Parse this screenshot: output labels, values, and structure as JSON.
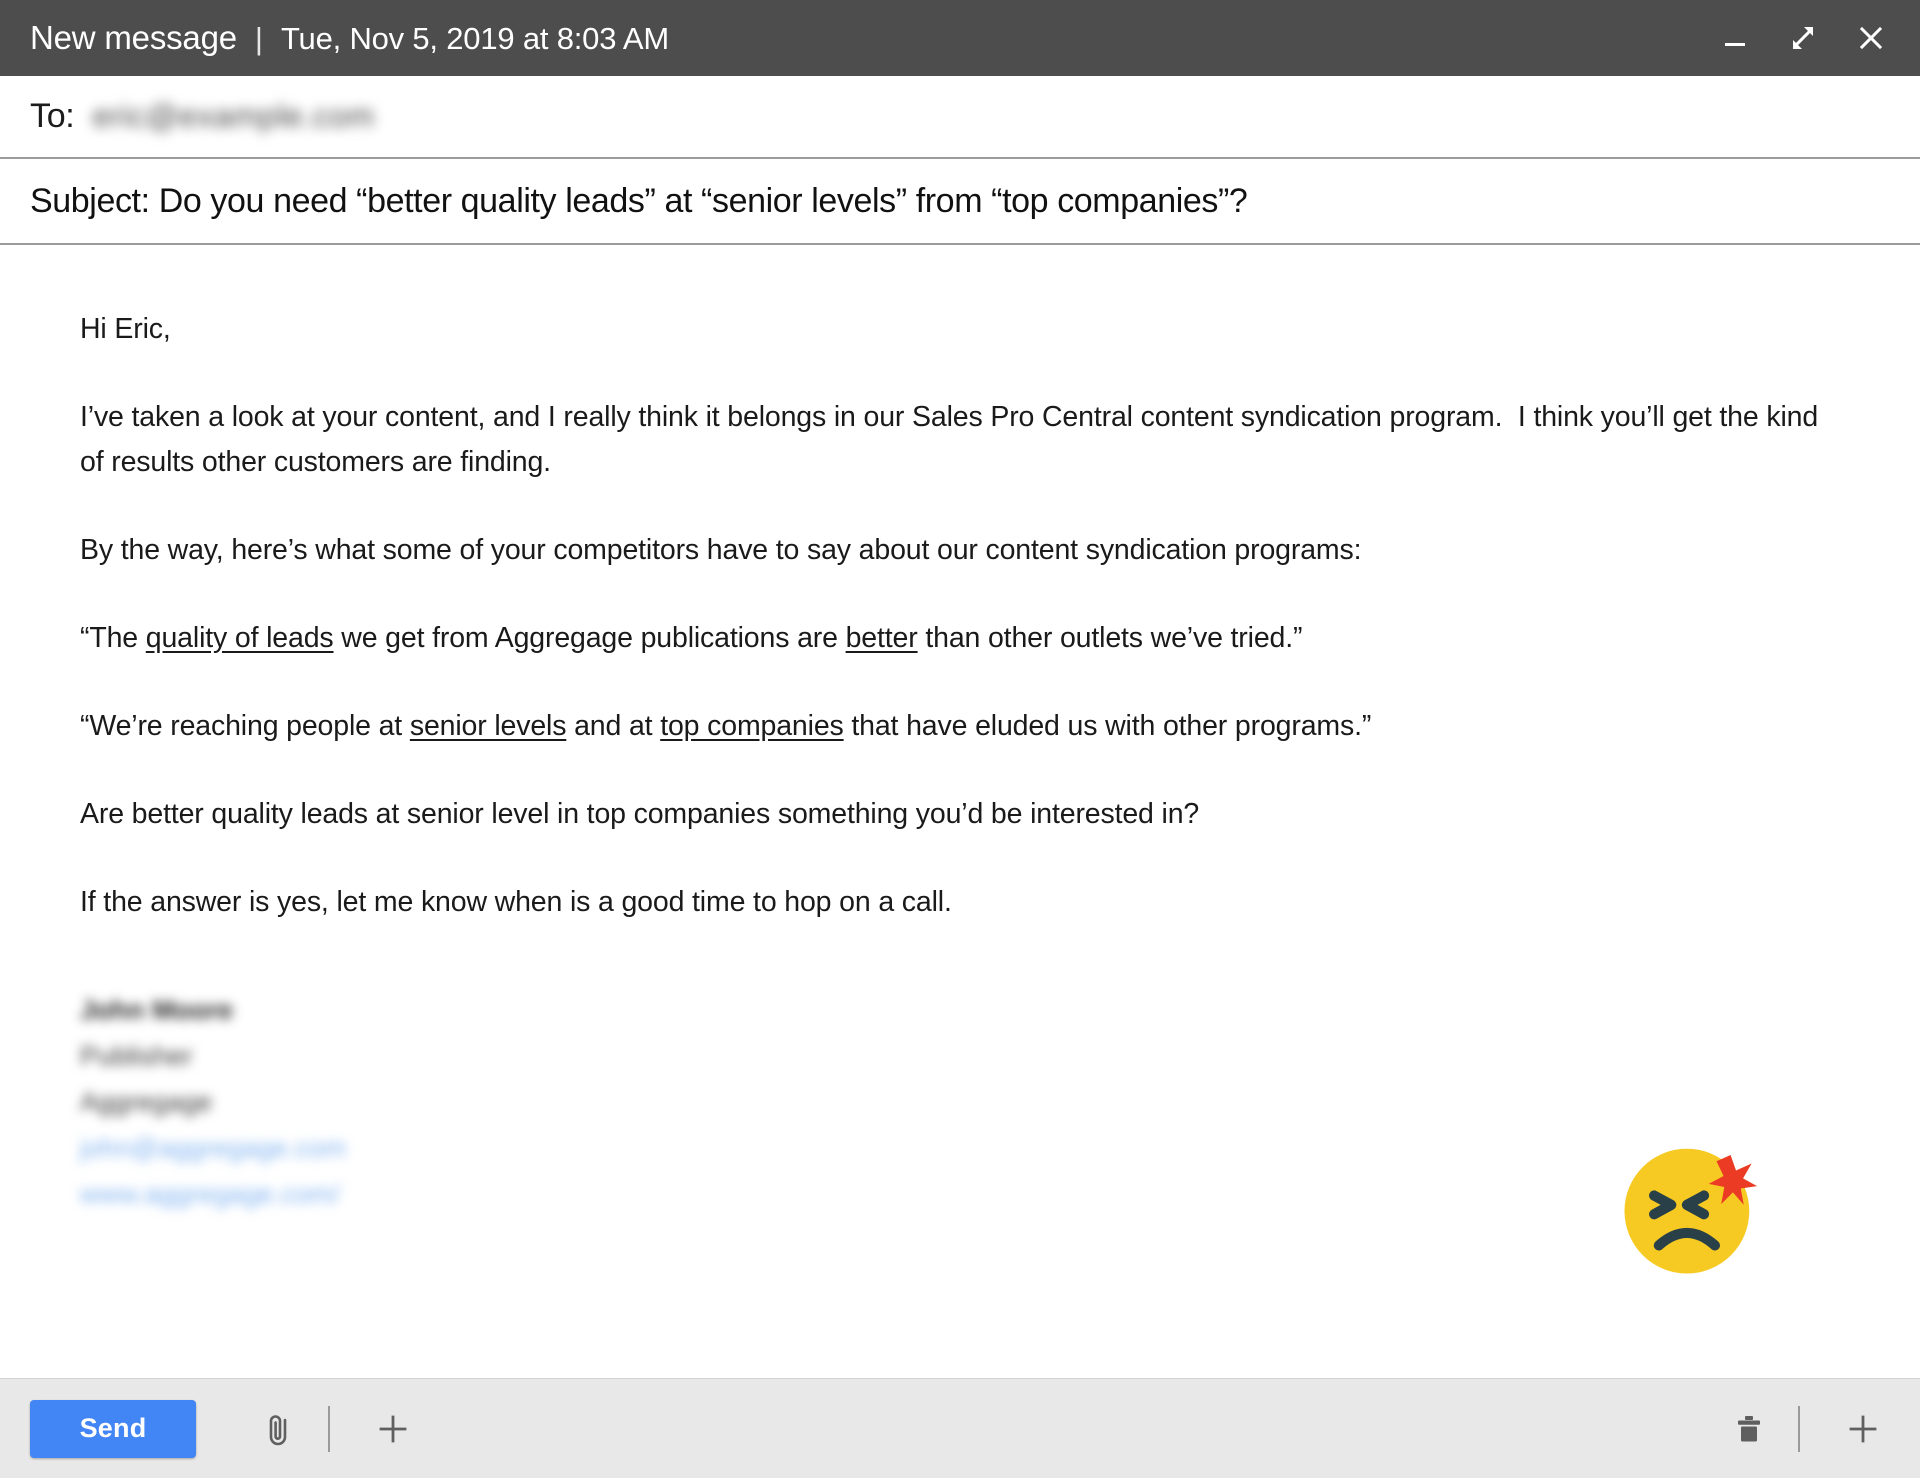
{
  "window": {
    "title": "New message",
    "separator": "|",
    "date": "Tue, Nov 5, 2019 at 8:03 AM",
    "controls": {
      "minimize": "minimize",
      "restore": "restore-down",
      "close": "close"
    },
    "titlebar_bg": "#4d4d4d"
  },
  "fields": {
    "to_label": "To:",
    "to_value": "eric@example.com",
    "subject_text": "Subject: Do you need “better quality leads” at “senior levels” from “top companies”?"
  },
  "body": {
    "greeting": "Hi Eric,",
    "p1_a": "I’ve taken a look at your content, and I really think it belongs in our Sales Pro Central content syndication program.",
    "p1_b": "I think you’ll get the kind of results other customers are finding.",
    "p2": "By the way, here’s what some of your competitors have to say about our content syndication programs:",
    "quote1": {
      "part1": "“The ",
      "underline1": "quality of leads",
      "part2": " we get from Aggregage publications are ",
      "underline2": "better",
      "part3": " than other outlets we’ve tried.”"
    },
    "quote2": {
      "part1": "“We’re reaching people at ",
      "underline1": "senior levels",
      "part2": " and at ",
      "underline2": "top companies",
      "part3": " that have eluded us with other programs.”"
    },
    "p3": "Are better quality leads at senior level in top companies something you’d be interested in?",
    "p4": "If the answer is yes, let me know when is a good time to hop on a call.",
    "signature": {
      "name": "John Moore",
      "title": "Publisher",
      "company": "Aggregage",
      "email": "john@aggregage.com",
      "website": "www.aggregage.com/"
    }
  },
  "emoji": {
    "name": "persevering-angry-face",
    "face_color": "#f6ca22",
    "feature_color": "#2a4049",
    "spark_color": "#eb3b24"
  },
  "toolbar": {
    "send_label": "Send",
    "send_color": "#4285f4",
    "attach_icon": "paperclip-icon",
    "add_icon": "plus-icon",
    "delete_icon": "trash-icon",
    "more_icon": "plus-icon"
  }
}
